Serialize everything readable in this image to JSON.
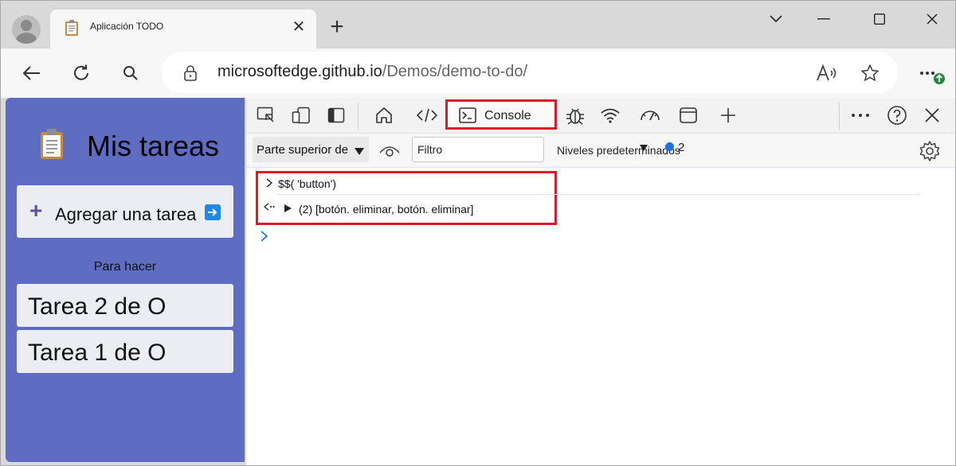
{
  "browser": {
    "tab": {
      "title": "Aplicación TODO",
      "close_glyph": "✕",
      "icon": "clipboard-icon"
    },
    "new_tab_glyph": "+",
    "url": {
      "host": "microsoftedge.github.io",
      "path": "/Demos/demo-to-do/"
    },
    "icons": {
      "back": "back-arrow-icon",
      "refresh": "refresh-icon",
      "search": "search-icon",
      "lock": "lock-icon",
      "read_aloud": "read-aloud-icon",
      "favorite": "star-icon",
      "more": "more-icon"
    }
  },
  "app": {
    "title": "Mis tareas",
    "add_button": {
      "plus": "+",
      "label": "Agregar una tarea"
    },
    "section_label": "Para hacer",
    "tasks": [
      {
        "label": "Tarea 2 de O"
      },
      {
        "label": "Tarea 1 de O"
      }
    ],
    "colors": {
      "background": "#5e6dc2",
      "card": "#ececf3"
    }
  },
  "devtools": {
    "console_tab_label": "Console",
    "context_selector": "Parte superior de",
    "filter": {
      "value": "Filtro"
    },
    "levels_label": "Niveles predeterminados",
    "issues_count": "2",
    "console": {
      "lines": [
        {
          "text": "$$( 'button')"
        },
        {
          "text": "(2) [botón. eliminar, botón. eliminar]"
        }
      ]
    },
    "highlight_color": "#d21f2b"
  }
}
